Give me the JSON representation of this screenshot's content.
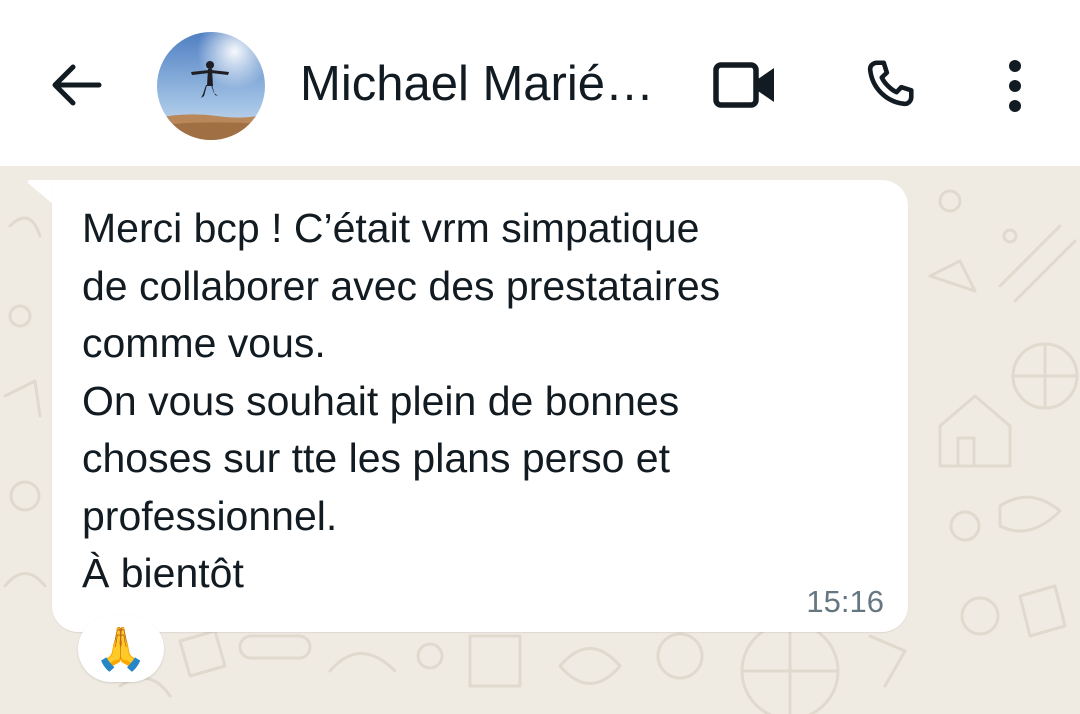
{
  "header": {
    "contact_name": "Michael Marié…",
    "back_icon": "arrow-left-icon",
    "avatar_icon": "contact-avatar",
    "video_icon": "video-camera-icon",
    "call_icon": "phone-icon",
    "menu_icon": "vertical-dots-icon"
  },
  "message": {
    "lines": [
      "Merci bcp ! C’était vrm simpatique",
      "de collaborer avec des prestataires",
      "comme vous.",
      "On vous souhait plein de bonnes",
      "choses sur tte les plans perso et",
      "professionnel.",
      "À bientôt"
    ],
    "time": "15:16",
    "reaction": "🙏"
  },
  "colors": {
    "header_bg": "#ffffff",
    "chat_bg": "#efeae2",
    "bubble_bg": "#ffffff",
    "text": "#111b21",
    "time_text": "#667781"
  }
}
